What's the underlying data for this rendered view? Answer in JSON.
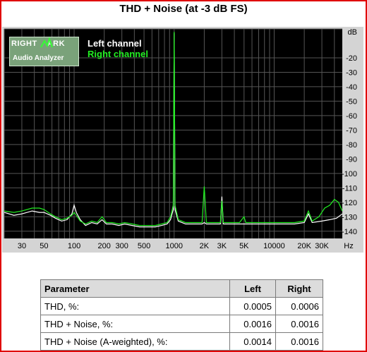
{
  "colors": {
    "frame": "#e00000",
    "plot_bg": "#000000",
    "left_channel": "#ffffff",
    "right_channel": "#22ee22",
    "grid": "#555555"
  },
  "logo": {
    "line1": "RIGHT",
    "line2": "ARK",
    "line3": "Audio Analyzer"
  },
  "chart_data": {
    "type": "line",
    "title": "THD + Noise (at -3 dB FS)",
    "xlabel": "Hz",
    "ylabel": "dB",
    "x_scale": "log",
    "xlim": [
      20,
      48000
    ],
    "ylim": [
      -145,
      0
    ],
    "xticks": [
      {
        "v": 30,
        "label": "30"
      },
      {
        "v": 50,
        "label": "50"
      },
      {
        "v": 100,
        "label": "100"
      },
      {
        "v": 200,
        "label": "200"
      },
      {
        "v": 300,
        "label": "300"
      },
      {
        "v": 500,
        "label": "500"
      },
      {
        "v": 1000,
        "label": "1000"
      },
      {
        "v": 2000,
        "label": "2K"
      },
      {
        "v": 3000,
        "label": "3K"
      },
      {
        "v": 5000,
        "label": "5K"
      },
      {
        "v": 10000,
        "label": "10000"
      },
      {
        "v": 20000,
        "label": "20K"
      },
      {
        "v": 30000,
        "label": "30K"
      }
    ],
    "yticks": [
      {
        "v": 0,
        "label": "dB"
      },
      {
        "v": -20,
        "label": "-20"
      },
      {
        "v": -30,
        "label": "-30"
      },
      {
        "v": -40,
        "label": "-40"
      },
      {
        "v": -50,
        "label": "-50"
      },
      {
        "v": -60,
        "label": "-60"
      },
      {
        "v": -70,
        "label": "-70"
      },
      {
        "v": -80,
        "label": "-80"
      },
      {
        "v": -90,
        "label": "-90"
      },
      {
        "v": -100,
        "label": "-100"
      },
      {
        "v": -110,
        "label": "-110"
      },
      {
        "v": -120,
        "label": "-120"
      },
      {
        "v": -130,
        "label": "-130"
      },
      {
        "v": -140,
        "label": "-140"
      }
    ],
    "legend": {
      "placement": "top-left"
    },
    "series": [
      {
        "name": "Left channel",
        "color": "#ffffff",
        "points": [
          [
            20,
            -127
          ],
          [
            25,
            -129
          ],
          [
            30,
            -128
          ],
          [
            38,
            -126
          ],
          [
            45,
            -127
          ],
          [
            50,
            -127
          ],
          [
            58,
            -129
          ],
          [
            65,
            -131
          ],
          [
            75,
            -133
          ],
          [
            85,
            -132
          ],
          [
            95,
            -128
          ],
          [
            100,
            -122
          ],
          [
            105,
            -127
          ],
          [
            115,
            -132
          ],
          [
            130,
            -136
          ],
          [
            150,
            -134
          ],
          [
            170,
            -135
          ],
          [
            190,
            -132
          ],
          [
            210,
            -135
          ],
          [
            240,
            -135
          ],
          [
            280,
            -136
          ],
          [
            320,
            -135
          ],
          [
            380,
            -136
          ],
          [
            450,
            -137
          ],
          [
            550,
            -137
          ],
          [
            650,
            -137
          ],
          [
            750,
            -136
          ],
          [
            850,
            -135
          ],
          [
            920,
            -132
          ],
          [
            980,
            -125
          ],
          [
            1000,
            -3
          ],
          [
            1020,
            -125
          ],
          [
            1100,
            -133
          ],
          [
            1300,
            -135
          ],
          [
            1600,
            -135
          ],
          [
            1900,
            -135
          ],
          [
            2000,
            -134
          ],
          [
            2100,
            -135
          ],
          [
            2500,
            -135
          ],
          [
            2900,
            -135
          ],
          [
            3000,
            -116
          ],
          [
            3100,
            -135
          ],
          [
            3500,
            -135
          ],
          [
            4500,
            -135
          ],
          [
            5500,
            -135
          ],
          [
            7000,
            -135
          ],
          [
            9000,
            -135
          ],
          [
            12000,
            -135
          ],
          [
            16000,
            -135
          ],
          [
            20000,
            -134
          ],
          [
            22000,
            -128
          ],
          [
            24000,
            -134
          ],
          [
            30000,
            -133
          ],
          [
            36000,
            -132
          ],
          [
            42000,
            -131
          ],
          [
            48000,
            -128
          ]
        ]
      },
      {
        "name": "Right channel",
        "color": "#22ee22",
        "points": [
          [
            20,
            -126
          ],
          [
            25,
            -127
          ],
          [
            30,
            -126
          ],
          [
            38,
            -124
          ],
          [
            45,
            -124
          ],
          [
            50,
            -125
          ],
          [
            58,
            -128
          ],
          [
            65,
            -130
          ],
          [
            75,
            -132
          ],
          [
            85,
            -131
          ],
          [
            95,
            -129
          ],
          [
            100,
            -127
          ],
          [
            105,
            -129
          ],
          [
            115,
            -133
          ],
          [
            130,
            -135
          ],
          [
            150,
            -133
          ],
          [
            170,
            -134
          ],
          [
            190,
            -130
          ],
          [
            210,
            -134
          ],
          [
            240,
            -134
          ],
          [
            280,
            -135
          ],
          [
            320,
            -134
          ],
          [
            380,
            -135
          ],
          [
            450,
            -136
          ],
          [
            550,
            -136
          ],
          [
            650,
            -136
          ],
          [
            750,
            -135
          ],
          [
            850,
            -134
          ],
          [
            920,
            -130
          ],
          [
            980,
            -122
          ],
          [
            1000,
            -2
          ],
          [
            1020,
            -122
          ],
          [
            1100,
            -132
          ],
          [
            1300,
            -134
          ],
          [
            1600,
            -134
          ],
          [
            1900,
            -134
          ],
          [
            2000,
            -109
          ],
          [
            2100,
            -134
          ],
          [
            2500,
            -134
          ],
          [
            2900,
            -134
          ],
          [
            3000,
            -119
          ],
          [
            3100,
            -134
          ],
          [
            3500,
            -134
          ],
          [
            4500,
            -134
          ],
          [
            5000,
            -130
          ],
          [
            5200,
            -134
          ],
          [
            7000,
            -134
          ],
          [
            9000,
            -134
          ],
          [
            12000,
            -134
          ],
          [
            16000,
            -134
          ],
          [
            20000,
            -133
          ],
          [
            22000,
            -126
          ],
          [
            24000,
            -133
          ],
          [
            28000,
            -130
          ],
          [
            32000,
            -124
          ],
          [
            36000,
            -122
          ],
          [
            40000,
            -118
          ],
          [
            44000,
            -120
          ],
          [
            48000,
            -126
          ]
        ]
      }
    ]
  },
  "table": {
    "headers": [
      "Parameter",
      "Left",
      "Right"
    ],
    "rows": [
      [
        "THD, %:",
        "0.0005",
        "0.0006"
      ],
      [
        "THD + Noise, %:",
        "0.0016",
        "0.0016"
      ],
      [
        "THD + Noise (A-weighted), %:",
        "0.0014",
        "0.0016"
      ]
    ]
  }
}
